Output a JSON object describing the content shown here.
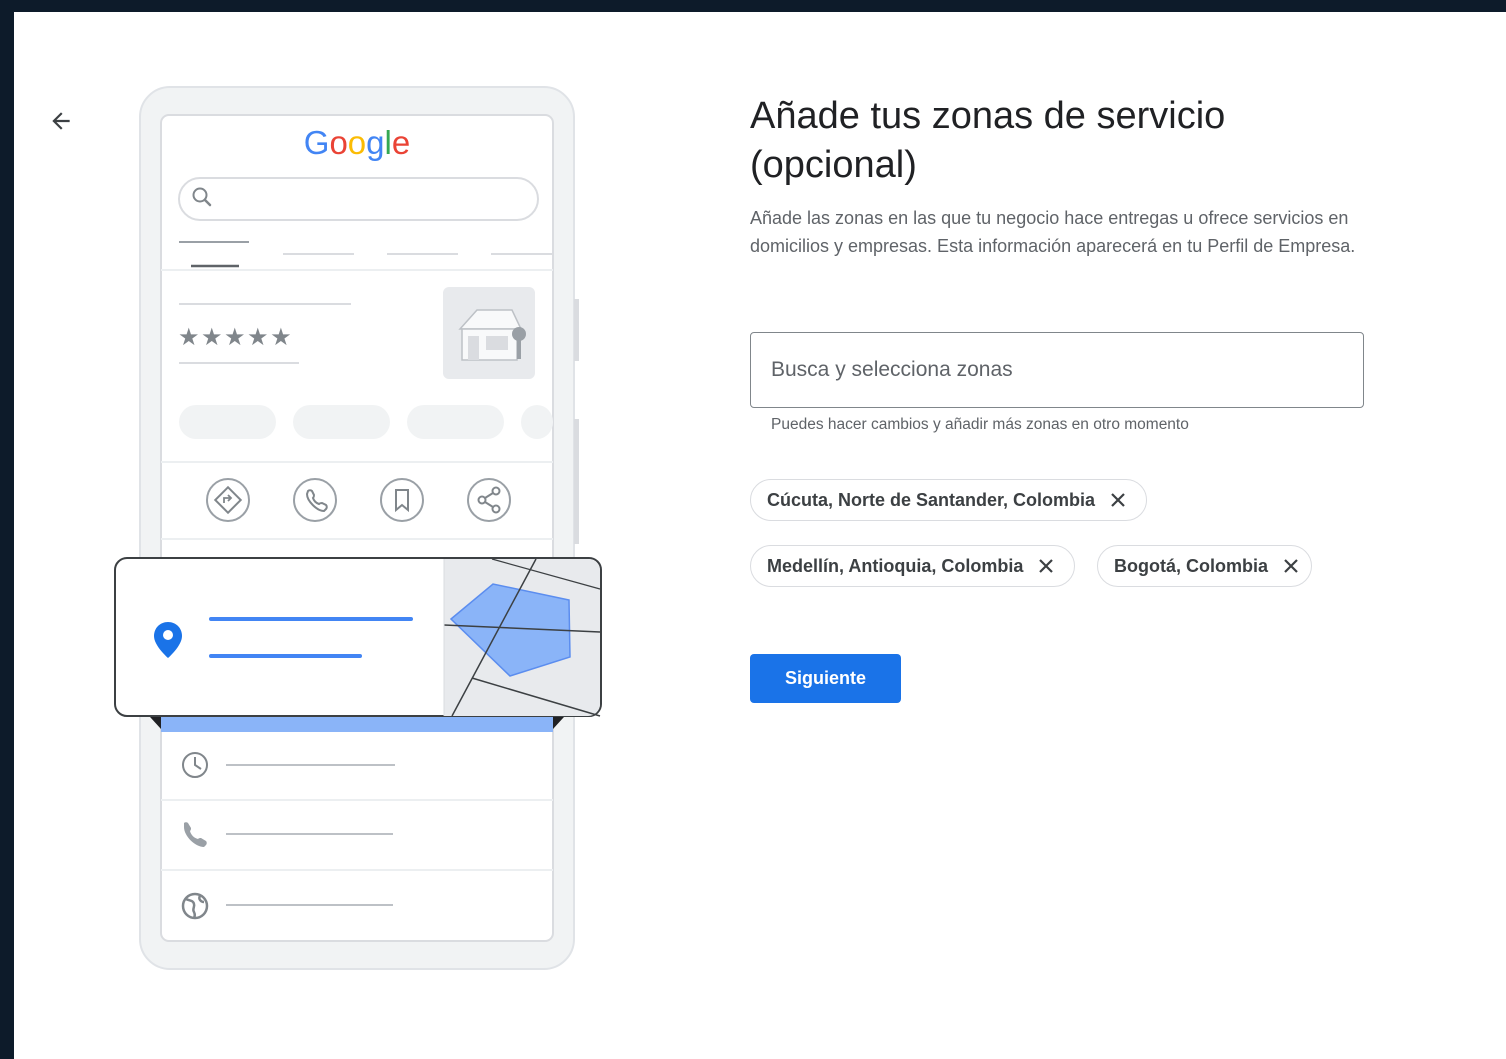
{
  "heading": "Añade tus zonas de servicio (opcional)",
  "description": "Añade las zonas en las que tu negocio hace entregas u ofrece servicios en domicilios y empresas. Esta información aparecerá en tu Perfil de Empresa.",
  "search": {
    "placeholder": "Busca y selecciona zonas",
    "helper": "Puedes hacer cambios y añadir más zonas en otro momento"
  },
  "zones": [
    {
      "label": "Cúcuta, Norte de Santander, Colombia"
    },
    {
      "label": "Medellín, Antioquia, Colombia"
    },
    {
      "label": "Bogotá, Colombia"
    }
  ],
  "next_label": "Siguiente",
  "illustration": {
    "logo": "Google",
    "rating_stars": "★★★★★"
  },
  "colors": {
    "primary": "#1a73e8",
    "map_polygon": "#8ab4f8",
    "background_border": "#0d1b2a"
  },
  "icons": [
    "back-arrow-icon",
    "search-icon",
    "directions-icon",
    "phone-icon",
    "bookmark-icon",
    "share-icon",
    "location-pin-icon",
    "clock-icon",
    "globe-icon",
    "close-icon"
  ]
}
